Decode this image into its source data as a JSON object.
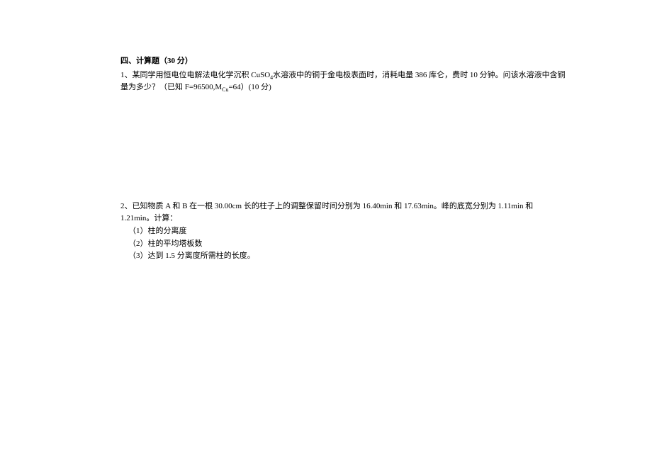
{
  "section": {
    "heading": "四、计算题（30 分）"
  },
  "q1": {
    "prefix": "1、某同学用恒电位电解法电化学沉积 CuSO",
    "sub1": "4",
    "mid1": "水溶液中的铜于金电极表面时，消耗电量 386 库仑，费时 10 分钟。问该水溶液中含铜量为多少？（已知 F=96500,M",
    "sub2": "Cu",
    "mid2": "=64）(10 分)"
  },
  "q2": {
    "line1": "2、已知物质 A 和 B 在一根 30.00cm 长的柱子上的调整保留时间分别为 16.40min 和 17.63min。峰的底宽分别为 1.11min 和 1.21min。计算：",
    "sub1": "（1）柱的分离度",
    "sub2": "（2）柱的平均塔板数",
    "sub3": "（3）达到 1.5 分离度所需柱的长度。"
  }
}
